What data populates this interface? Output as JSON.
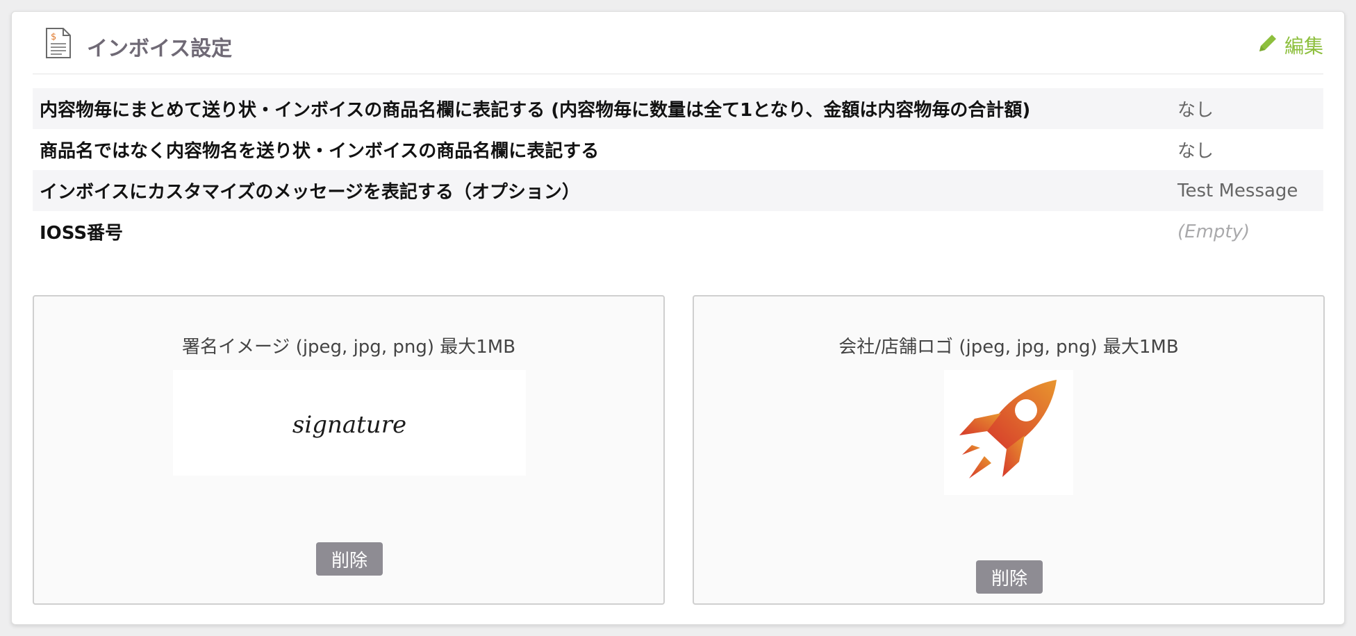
{
  "header": {
    "title": "インボイス設定",
    "edit_label": "編集",
    "icon": "invoice-document-icon",
    "edit_icon": "pencil-icon",
    "accent_color": "#8dbf3d"
  },
  "settings": [
    {
      "label": "内容物毎にまとめて送り状・インボイスの商品名欄に表記する (内容物毎に数量は全て1となり、金額は内容物毎の合計額)",
      "value": "なし"
    },
    {
      "label": "商品名ではなく内容物名を送り状・インボイスの商品名欄に表記する",
      "value": "なし"
    },
    {
      "label": "インボイスにカスタマイズのメッセージを表記する（オプション）",
      "value": "Test Message"
    },
    {
      "label": "IOSS番号",
      "value": "(Empty)"
    }
  ],
  "signature_upload": {
    "title": "署名イメージ (jpeg, jpg, png) 最大1MB",
    "preview_text": "signature",
    "delete_label": "削除"
  },
  "logo_upload": {
    "title": "会社/店舗ロゴ (jpeg, jpg, png) 最大1MB",
    "logo_icon": "rocket-icon",
    "delete_label": "削除"
  }
}
